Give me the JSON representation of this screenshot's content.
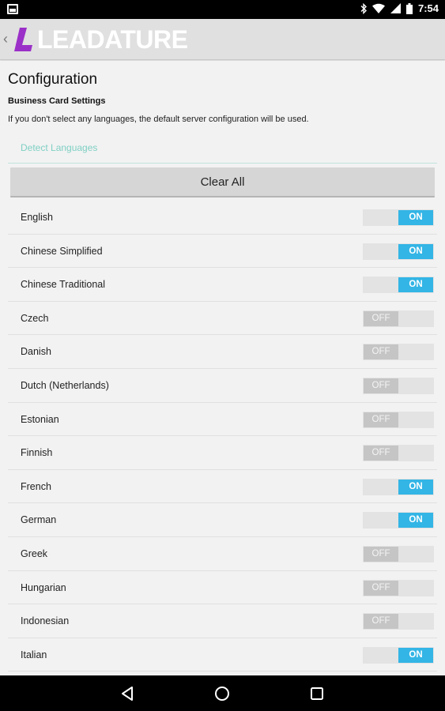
{
  "status_bar": {
    "time": "7:54",
    "icons": [
      "screenshot-icon",
      "bluetooth-icon",
      "wifi-icon",
      "signal-icon",
      "battery-icon"
    ]
  },
  "app_bar": {
    "logo_text": "LEADATURE",
    "back_glyph": "‹",
    "colors": {
      "logo_mark": "#9b30c8",
      "bar_bg": "#e0e0e0"
    }
  },
  "page": {
    "title": "Configuration",
    "section_title": "Business Card Settings",
    "hint": "If you don't select any languages, the default server configuration will be used.",
    "detect_link": "Detect Languages",
    "clear_all_label": "Clear All"
  },
  "toggle_labels": {
    "on": "ON",
    "off": "OFF"
  },
  "colors": {
    "toggle_on": "#33b5e5",
    "link": "#7fd0c4"
  },
  "languages": [
    {
      "name": "English",
      "state": "ON"
    },
    {
      "name": "Chinese Simplified",
      "state": "ON"
    },
    {
      "name": "Chinese Traditional",
      "state": "ON"
    },
    {
      "name": "Czech",
      "state": "OFF"
    },
    {
      "name": "Danish",
      "state": "OFF"
    },
    {
      "name": "Dutch (Netherlands)",
      "state": "OFF"
    },
    {
      "name": "Estonian",
      "state": "OFF"
    },
    {
      "name": "Finnish",
      "state": "OFF"
    },
    {
      "name": "French",
      "state": "ON"
    },
    {
      "name": "German",
      "state": "ON"
    },
    {
      "name": "Greek",
      "state": "OFF"
    },
    {
      "name": "Hungarian",
      "state": "OFF"
    },
    {
      "name": "Indonesian",
      "state": "OFF"
    },
    {
      "name": "Italian",
      "state": "ON"
    }
  ],
  "nav_bar": {
    "buttons": [
      "back-triangle-icon",
      "home-circle-icon",
      "recents-square-icon"
    ]
  }
}
